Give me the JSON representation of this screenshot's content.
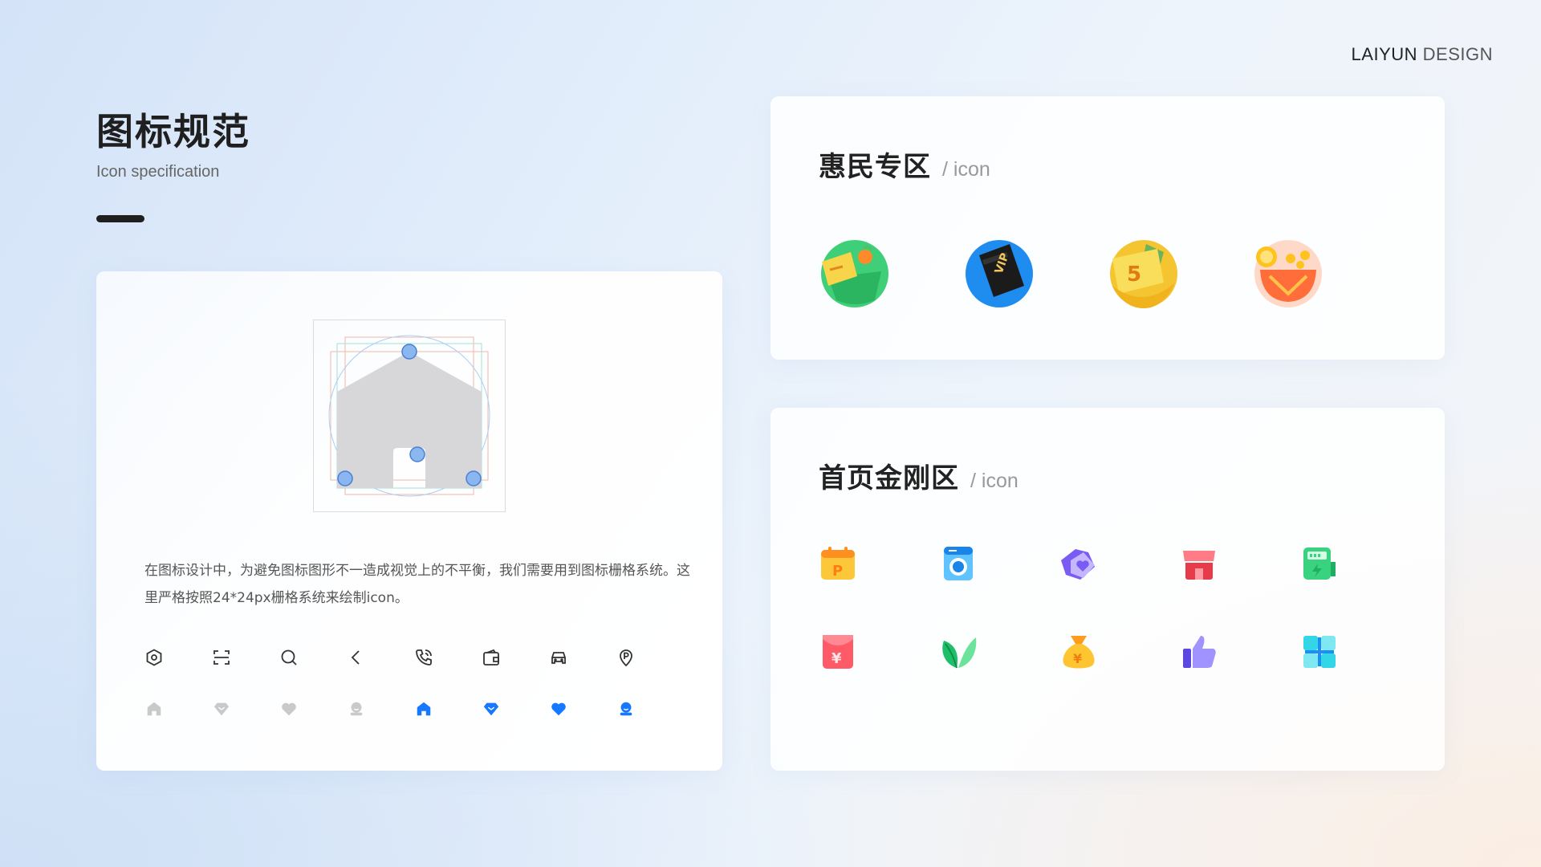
{
  "brand": {
    "bold": "LAIYUN",
    "light": " DESIGN"
  },
  "header": {
    "title": "图标规范",
    "subtitle": "Icon specification"
  },
  "left_card": {
    "description": "在图标设计中，为避免图标图形不一造成视觉上的不平衡，我们需要用到图标栅格系统。这里严格按照24*24px栅格系统来绘制icon。",
    "outline_icons": [
      "settings-hexagon-icon",
      "scan-icon",
      "search-icon",
      "chevron-left-icon",
      "phone-call-icon",
      "wallet-icon",
      "car-icon",
      "parking-pin-icon"
    ],
    "filled_icons": [
      "home-icon",
      "diamond-icon",
      "heart-icon",
      "user-icon",
      "home-icon",
      "diamond-icon",
      "heart-icon",
      "user-icon"
    ],
    "colors": {
      "inactive": "#c9c9c9",
      "active": "#1677ff",
      "outline": "#333333"
    }
  },
  "promo_section": {
    "title": "惠民专区",
    "suffix": "/ icon",
    "icons": [
      "chips-basket-icon",
      "vip-card-icon",
      "coupon-5-yuan-icon",
      "gold-coins-bowl-icon"
    ]
  },
  "feature_section": {
    "title": "首页金刚区",
    "suffix": "/ icon",
    "icons": [
      "calendar-parking-icon",
      "washing-machine-icon",
      "home-heart-icon",
      "store-icon",
      "ev-charging-icon",
      "red-envelope-icon",
      "leaf-icon",
      "money-bag-icon",
      "thumbs-up-icon",
      "apps-grid-icon"
    ]
  }
}
